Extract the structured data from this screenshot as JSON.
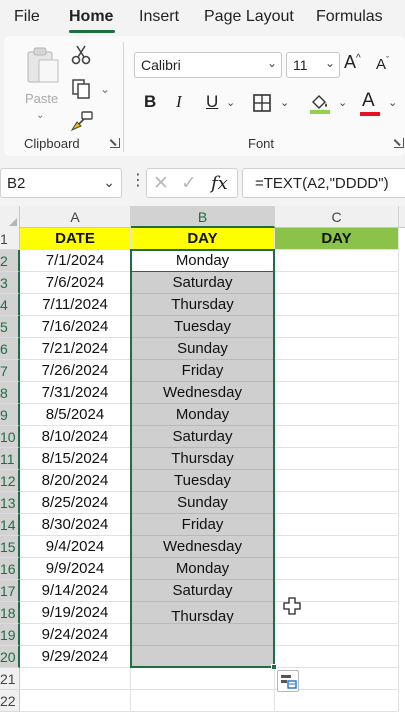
{
  "menu": {
    "tabs": [
      "File",
      "Home",
      "Insert",
      "Page Layout",
      "Formulas"
    ],
    "active_tab": "Home"
  },
  "ribbon": {
    "clipboard": {
      "paste_label": "Paste",
      "group_label": "Clipboard"
    },
    "font": {
      "font_name": "Calibri",
      "font_size": "11",
      "group_label": "Font",
      "bold": "B",
      "italic": "I",
      "underline": "U",
      "grow_font": "A",
      "shrink_font": "A",
      "font_color": "A",
      "fill_color": "#92d050",
      "font_color_swatch": "#e81123"
    }
  },
  "formula_bar": {
    "name_box": "B2",
    "fx": "fx",
    "formula": "=TEXT(A2,\"DDDD\")"
  },
  "sheet": {
    "columns": [
      "A",
      "B",
      "C"
    ],
    "selected_column": "B",
    "header_row": {
      "date": "DATE",
      "day_b": "DAY",
      "day_c": "DAY"
    },
    "header_colors": {
      "date": "#ffff00",
      "day_b": "#ffff00",
      "day_c": "#8bc34a"
    },
    "selection_color": "#1e6e42",
    "row_numbers": [
      "1",
      "2",
      "3",
      "4",
      "5",
      "6",
      "7",
      "8",
      "9",
      "10",
      "11",
      "12",
      "13",
      "14",
      "15",
      "16",
      "17",
      "18",
      "19",
      "20",
      "21",
      "22"
    ],
    "rows": [
      {
        "date": "7/1/2024",
        "day": "Monday"
      },
      {
        "date": "7/6/2024",
        "day": "Saturday"
      },
      {
        "date": "7/11/2024",
        "day": "Thursday"
      },
      {
        "date": "7/16/2024",
        "day": "Tuesday"
      },
      {
        "date": "7/21/2024",
        "day": "Sunday"
      },
      {
        "date": "7/26/2024",
        "day": "Friday"
      },
      {
        "date": "7/31/2024",
        "day": "Wednesday"
      },
      {
        "date": "8/5/2024",
        "day": "Monday"
      },
      {
        "date": "8/10/2024",
        "day": "Saturday"
      },
      {
        "date": "8/15/2024",
        "day": "Thursday"
      },
      {
        "date": "8/20/2024",
        "day": "Tuesday"
      },
      {
        "date": "8/25/2024",
        "day": "Sunday"
      },
      {
        "date": "8/30/2024",
        "day": "Friday"
      },
      {
        "date": "9/4/2024",
        "day": "Wednesday"
      },
      {
        "date": "9/9/2024",
        "day": "Monday"
      },
      {
        "date": "9/14/2024",
        "day": "Saturday"
      },
      {
        "date": "9/19/2024",
        "day": "Thursday"
      },
      {
        "date": "9/24/2024",
        "day": ""
      },
      {
        "date": "9/29/2024",
        "day": ""
      }
    ]
  }
}
